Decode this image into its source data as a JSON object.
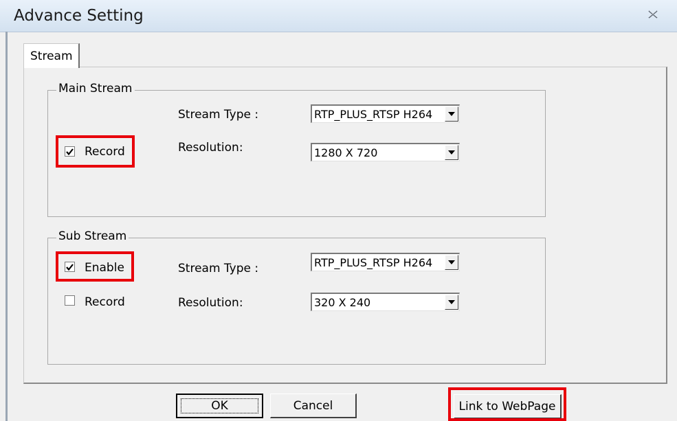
{
  "window": {
    "title": "Advance Setting"
  },
  "tabs": [
    {
      "label": "Stream"
    }
  ],
  "main_stream": {
    "legend": "Main Stream",
    "record": {
      "label": "Record",
      "checked": true
    },
    "stream_type_label": "Stream Type :",
    "stream_type_value": "RTP_PLUS_RTSP H264",
    "resolution_label": "Resolution:",
    "resolution_value": "1280 X 720"
  },
  "sub_stream": {
    "legend": "Sub Stream",
    "enable": {
      "label": "Enable",
      "checked": true
    },
    "record": {
      "label": "Record",
      "checked": false
    },
    "stream_type_label": "Stream Type :",
    "stream_type_value": "RTP_PLUS_RTSP H264",
    "resolution_label": "Resolution:",
    "resolution_value": "320 X 240"
  },
  "buttons": {
    "ok": "OK",
    "cancel": "Cancel",
    "link": "Link to WebPage"
  },
  "colors": {
    "highlight": "#e8000b",
    "titlebar": "#dce8f4",
    "dialog_background": "#f0f0f0"
  },
  "icons": {
    "close": "close-icon",
    "checkmark": "checkmark-icon",
    "dropdown": "chevron-down-icon"
  }
}
